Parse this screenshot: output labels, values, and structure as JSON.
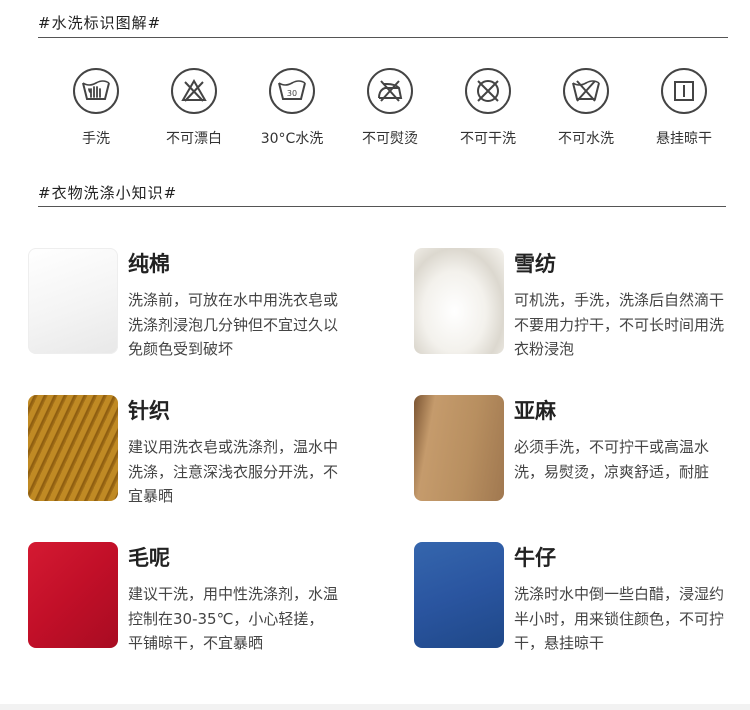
{
  "wash_section": {
    "title": "#水洗标识图解#",
    "icons": [
      {
        "label": "手洗",
        "icon": "hand-wash-icon"
      },
      {
        "label": "不可漂白",
        "icon": "no-bleach-icon"
      },
      {
        "label": "30°C水洗",
        "icon": "wash-30-icon",
        "temp": "30"
      },
      {
        "label": "不可熨烫",
        "icon": "no-iron-icon"
      },
      {
        "label": "不可干洗",
        "icon": "no-dry-clean-icon"
      },
      {
        "label": "不可水洗",
        "icon": "no-wash-icon"
      },
      {
        "label": "悬挂晾干",
        "icon": "hang-dry-icon"
      }
    ]
  },
  "knowledge_section": {
    "title": "#衣物洗涤小知识#",
    "fabrics": [
      {
        "name": "纯棉",
        "desc": "洗涤前，可放在水中用洗衣皂或洗涤剂浸泡几分钟但不宜过久以免颜色受到破坏",
        "color": "#ffffff"
      },
      {
        "name": "雪纺",
        "desc": "可机洗，手洗，洗涤后自然滴干不要用力拧干，不可长时间用洗衣粉浸泡",
        "color": "#f2f0eb"
      },
      {
        "name": "针织",
        "desc": "建议用洗衣皂或洗涤剂，温水中洗涤，注意深浅衣服分开洗，不宜暴晒",
        "color": "#b07a1a"
      },
      {
        "name": "亚麻",
        "desc": "必须手洗，不可拧干或高温水洗，易熨烫，凉爽舒适，耐脏",
        "color": "#b08a5e"
      },
      {
        "name": "毛呢",
        "desc": "建议干洗，用中性洗涤剂，水温控制在30-35℃，小心轻搓，平铺晾干，不宜暴晒",
        "color": "#c8102e"
      },
      {
        "name": "牛仔",
        "desc": "洗涤时水中倒一些白醋，浸湿约半小时，用来锁住颜色，不可拧干，悬挂晾干",
        "color": "#2c5aa0"
      }
    ]
  }
}
